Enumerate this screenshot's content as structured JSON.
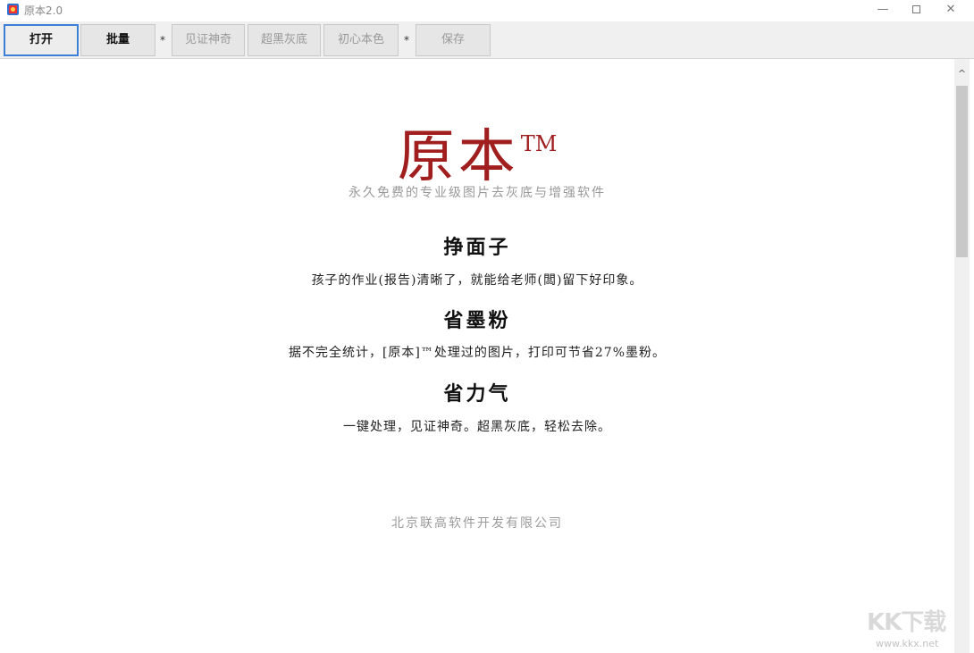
{
  "window": {
    "title": "原本2.0",
    "minimize": "—",
    "close": "✕"
  },
  "toolbar": {
    "open": "打开",
    "batch": "批量",
    "sep1": "*",
    "witness": "见证神奇",
    "super_black": "超黑灰底",
    "original_color": "初心本色",
    "sep2": "*",
    "save": "保存"
  },
  "content": {
    "logo": "原本",
    "tm": "TM",
    "subtitle": "永久免费的专业级图片去灰底与增强软件",
    "features": [
      {
        "title": "挣面子",
        "desc": "孩子的作业(报告)清晰了，就能给老师(闆)留下好印象。"
      },
      {
        "title": "省墨粉",
        "desc": "据不完全统计，[原本]™处理过的图片，打印可节省27%墨粉。"
      },
      {
        "title": "省力气",
        "desc": "一键处理，见证神奇。超黑灰底，轻松去除。"
      }
    ],
    "company": "北京联高软件开发有限公司"
  },
  "scrollbar": {
    "up_arrow": "^"
  },
  "watermark": {
    "main": "KK下载",
    "url": "www.kkx.net"
  },
  "colors": {
    "logo": "#a01e1e",
    "focus_border": "#3c7fd6"
  }
}
